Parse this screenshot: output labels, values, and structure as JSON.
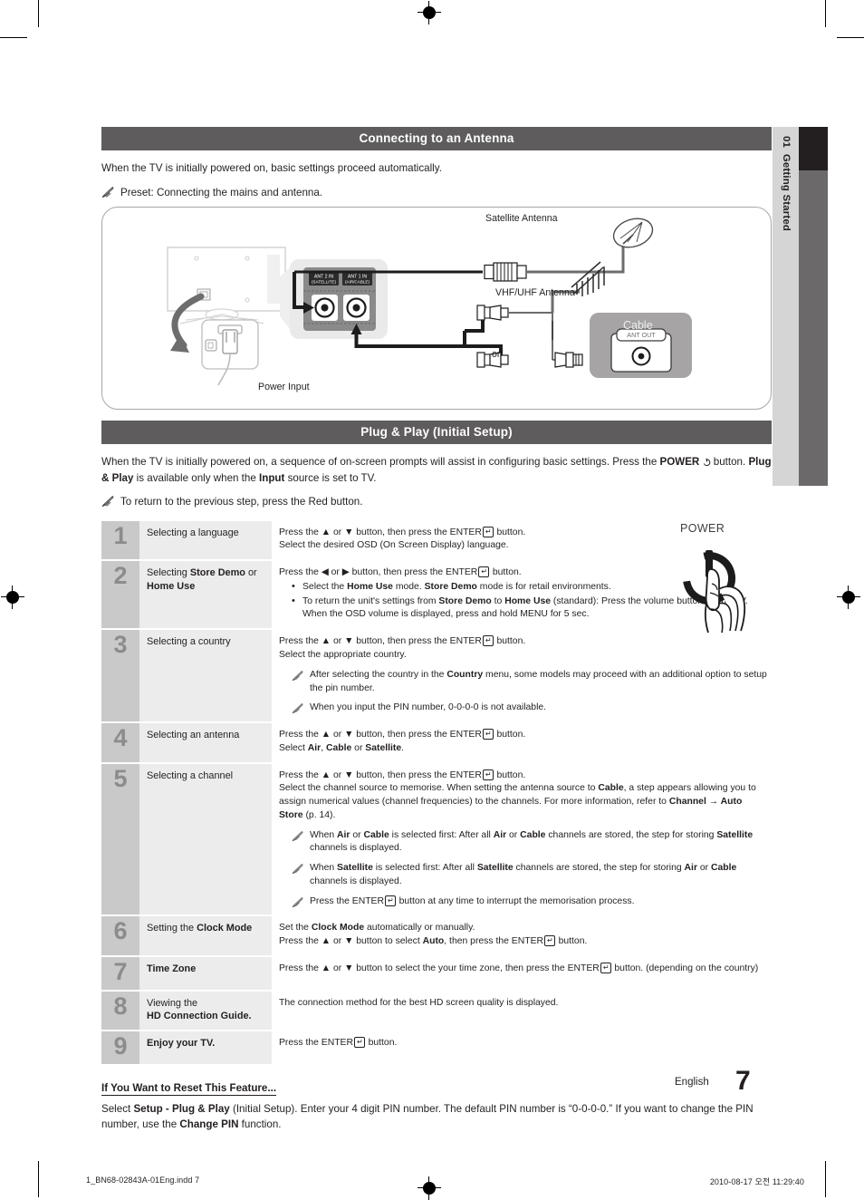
{
  "section1": {
    "title": "Connecting to an Antenna",
    "intro": "When the TV is initially powered on, basic settings proceed automatically.",
    "note": "Preset: Connecting the mains and antenna."
  },
  "diagram": {
    "power_input_label": "Power Input",
    "satellite_label": "Satellite Antenna",
    "vhf_uhf_label": "VHF/UHF Antenna",
    "or_label": "or",
    "cable_box_label": "Cable",
    "ant_out_label": "ANT OUT",
    "port2_line1": "ANT 2 IN",
    "port2_line2": "(SATELLITE)",
    "port1_line1": "ANT 1 IN",
    "port1_line2": "(AIR/CABLE)"
  },
  "section2": {
    "title": "Plug & Play (Initial Setup)",
    "intro_a": "When the TV is initially powered on, a sequence of on-screen prompts will assist in configuring basic settings. Press the ",
    "intro_power": "POWER",
    "intro_b": " button. ",
    "intro_pnp": "Plug & Play",
    "intro_c": " is available only when the ",
    "intro_input": "Input",
    "intro_d": " source is set to TV.",
    "note": "To return to the previous step, press the Red button."
  },
  "power_illustration": {
    "caption": "POWER"
  },
  "steps": [
    {
      "number": "1",
      "title_plain": "Selecting a language",
      "lines": [
        "Press the ▲ or ▼ button, then press the ENTER[E] button.",
        "Select the desired OSD (On Screen Display) language."
      ]
    },
    {
      "number": "2",
      "title_prefix": "Selecting ",
      "title_bold": "Store Demo",
      "title_suffix": " or",
      "title_line2": "Home Use",
      "lead": "Press the ◀ or ▶ button, then press the ENTER[E] button.",
      "bullets": [
        "Select the Home Use mode. Store Demo mode is for retail environments.",
        "To return the unit's settings from Store Demo to Home Use (standard): Press the volume button on the TV. When the OSD volume is displayed, press and hold MENU for 5 sec."
      ]
    },
    {
      "number": "3",
      "title_plain": "Selecting a country",
      "lines": [
        "Press the ▲ or ▼ button, then press the ENTER[E] button.",
        "Select the appropriate country."
      ],
      "notes": [
        "After selecting the country in the Country menu, some models may proceed with an additional option to setup the pin number.",
        "When you input the PIN number, 0-0-0-0 is not available."
      ]
    },
    {
      "number": "4",
      "title_plain": "Selecting an antenna",
      "lines": [
        "Press the ▲ or ▼ button, then press the ENTER[E] button.",
        "Select Air, Cable or Satellite."
      ]
    },
    {
      "number": "5",
      "title_plain": "Selecting a channel",
      "lines": [
        "Press the ▲ or ▼ button, then press the ENTER[E] button.",
        "Select the channel source to memorise. When setting the antenna source to Cable, a step appears allowing you to assign numerical values (channel frequencies) to the channels. For more information, refer to Channel → Auto Store (p. 14)."
      ],
      "notes": [
        "When Air or Cable is selected first: After all Air or Cable channels are stored, the step for storing Satellite channels is displayed.",
        "When Satellite is selected first: After all Satellite channels are stored, the step for storing Air or Cable channels is displayed.",
        "Press the ENTER[E] button at any time to interrupt the memorisation process."
      ]
    },
    {
      "number": "6",
      "title_prefix": "Setting the ",
      "title_bold": "Clock Mode",
      "lines": [
        "Set the Clock Mode automatically or manually.",
        "Press the ▲ or ▼ button to select Auto, then press the ENTER[E] button."
      ]
    },
    {
      "number": "7",
      "title_bold_only": "Time Zone",
      "lines": [
        "Press the ▲ or ▼ button to select the your time zone, then press the ENTER[E] button. (depending on the country)"
      ]
    },
    {
      "number": "8",
      "title_plain": "Viewing the",
      "title_line2_bold": "HD Connection Guide.",
      "lines": [
        "The connection method for the best HD screen quality is displayed."
      ]
    },
    {
      "number": "9",
      "title_bold_only": "Enjoy your TV.",
      "lines": [
        "Press the ENTER[E] button."
      ]
    }
  ],
  "reset": {
    "heading": "If You Want to Reset This Feature...",
    "body_a": "Select ",
    "body_bold1": "Setup - Plug & Play",
    "body_b": " (Initial Setup). Enter your 4 digit PIN number. The default PIN number is “0-0-0-0.” If you want to change the PIN number, use the ",
    "body_bold2": "Change PIN",
    "body_c": " function."
  },
  "sidebar": {
    "chapter_number": "01",
    "chapter_title": "Getting Started"
  },
  "footer": {
    "language": "English",
    "page_number": "7",
    "file_name": "1_BN68-02843A-01Eng.indd   7",
    "timestamp": "2010-08-17   오전 11:29:40"
  },
  "colors": {
    "bar": "#5e5c5c",
    "num_cell": "#c9c9c9",
    "title_cell": "#ececec",
    "tab_light": "#d5d5d5",
    "tab_dark": "#231f20",
    "tab_gray": "#6b6969"
  }
}
